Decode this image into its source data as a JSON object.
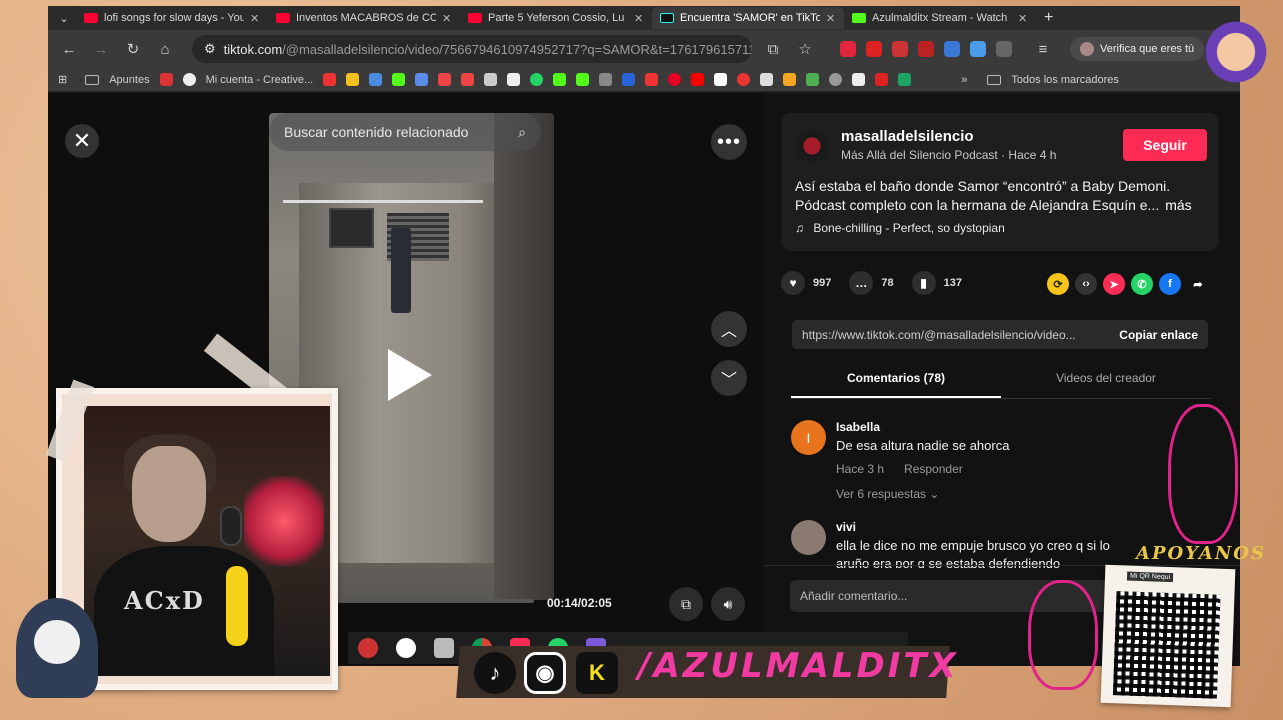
{
  "browser": {
    "tabs": [
      {
        "title": "lofi songs for slow days - You",
        "favicon_color": "#ff0033"
      },
      {
        "title": "Inventos MACABROS de CO",
        "favicon_color": "#ff0033"
      },
      {
        "title": "Parte 5 Yeferson Cossio, Lu",
        "favicon_color": "#ff0033"
      },
      {
        "title": "Encuentra 'SAMOR' en TikTo",
        "favicon_color": "#25f4ee"
      },
      {
        "title": "Azulmalditx Stream - Watch",
        "favicon_color": "#53fc18"
      }
    ],
    "url_host": "tiktok.com",
    "url_path": "/@masalladelsilencio/video/7566794610974952717?q=SAMOR&t=1761796157116",
    "verify_label": "Verifica que eres tú",
    "bookmarks": [
      "Apuntes",
      "Mi cuenta - Creative...",
      "Todos los marcadores"
    ]
  },
  "video": {
    "search_placeholder": "Buscar contenido relacionado",
    "time": "00:14/02:05",
    "progress": 0.112
  },
  "post": {
    "username": "masalladelsilencio",
    "subtitle": "Más Allá del Silencio Podcast · Hace 4 h",
    "follow_label": "Seguir",
    "description": "Así estaba el baño donde Samor “encontró” a Baby Demoni. Pódcast completo con la hermana de Alejandra Esquín e...",
    "more_label": "más",
    "music": "Bone-chilling - Perfect, so dystopian",
    "likes": "997",
    "comments": "78",
    "saves": "137",
    "link": "https://www.tiktok.com/@masalladelsilencio/video...",
    "copy_label": "Copiar enlace",
    "tab_comments": "Comentarios (78)",
    "tab_creator": "Videos del creador"
  },
  "comments": [
    {
      "name": "Isabella",
      "text": "De esa altura nadie se ahorca",
      "time": "Hace 3 h",
      "reply": "Responder",
      "replies": "Ver 6 respuestas",
      "avatar_letter": "I",
      "avatar_color": "#e8741e"
    },
    {
      "name": "vivi",
      "text": "ella le dice no me empuje brusco yo creo q si lo",
      "text2": "aruño era por q se estaba defendiendo",
      "avatar_letter": "",
      "avatar_color": "#8b7a70"
    }
  ],
  "add_comment_placeholder": "Añadir comentario...",
  "overlay": {
    "handle": "/AZULMALDITX",
    "apoyanos": "APOYANOS",
    "qr_caption": "Mi QR Nequi",
    "shirt_text": "ACxD"
  },
  "colors": {
    "accent": "#fe2c55",
    "handle": "#f23aa3",
    "gold": "#e9c64a"
  }
}
